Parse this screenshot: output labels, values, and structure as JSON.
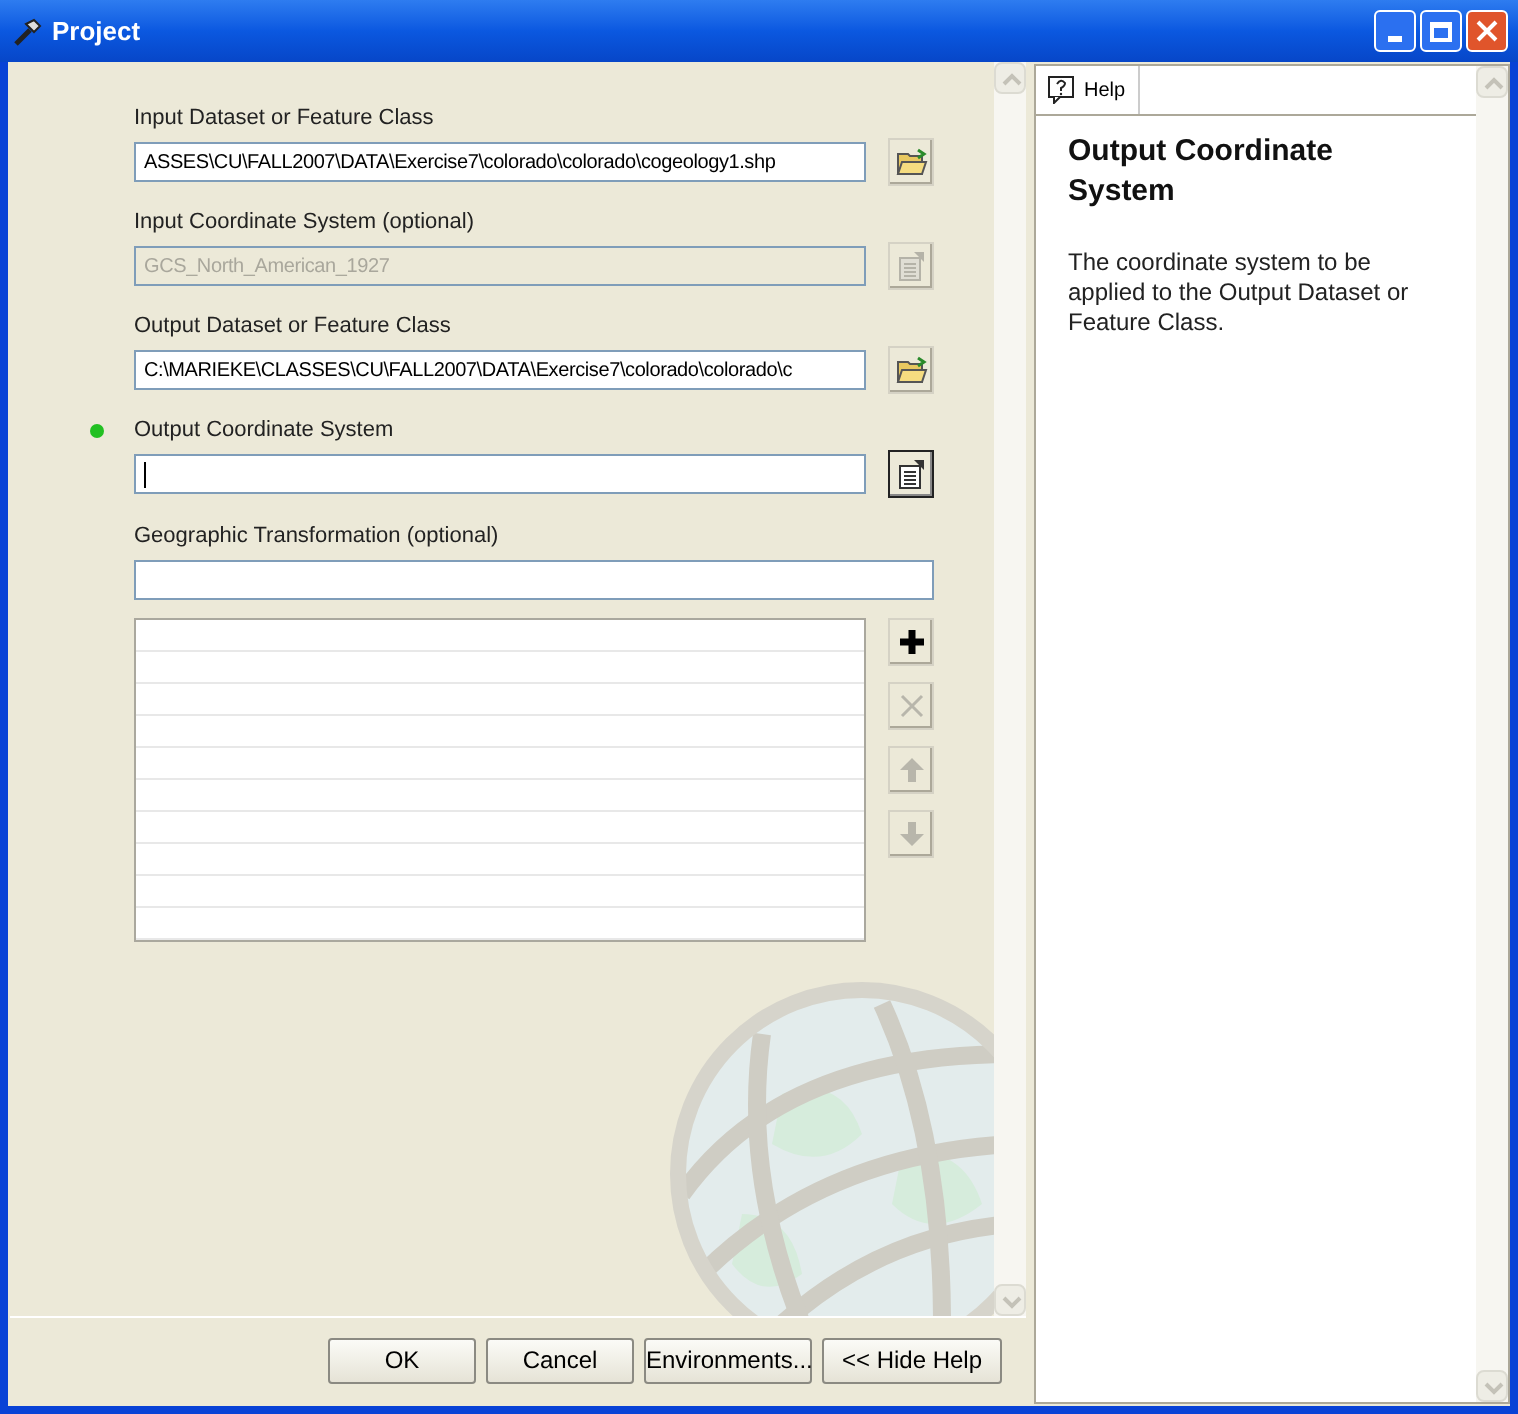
{
  "window": {
    "title": "Project"
  },
  "fields": [
    {
      "kind": "dataset",
      "label": "Input Dataset or Feature Class",
      "value": "ASSES\\CU\\FALL2007\\DATA\\Exercise7\\colorado\\colorado\\cogeology1.shp",
      "disabled": false,
      "required": false,
      "focused": false
    },
    {
      "kind": "coordinate",
      "label": "Input Coordinate System (optional)",
      "value": "GCS_North_American_1927",
      "disabled": true,
      "required": false,
      "focused": false
    },
    {
      "kind": "dataset",
      "label": "Output Dataset or Feature Class",
      "value": "C:\\MARIEKE\\CLASSES\\CU\\FALL2007\\DATA\\Exercise7\\colorado\\colorado\\c",
      "disabled": false,
      "required": false,
      "focused": false
    },
    {
      "kind": "coordinate",
      "label": "Output Coordinate System",
      "disabled": false,
      "required": true,
      "focused": true
    }
  ],
  "transformation": {
    "label": "Geographic Transformation (optional)",
    "list_buttons": [
      {
        "kind": "add",
        "disabled": false
      },
      {
        "kind": "remove",
        "disabled": true
      },
      {
        "kind": "up",
        "disabled": true
      },
      {
        "kind": "down",
        "disabled": true
      }
    ]
  },
  "buttons": [
    "OK",
    "Cancel",
    "Environments...",
    "<< Hide Help"
  ],
  "help": {
    "tab": "Help",
    "title": "Output Coordinate System",
    "text": "The coordinate system to be applied to the Output Dataset or Feature Class."
  }
}
